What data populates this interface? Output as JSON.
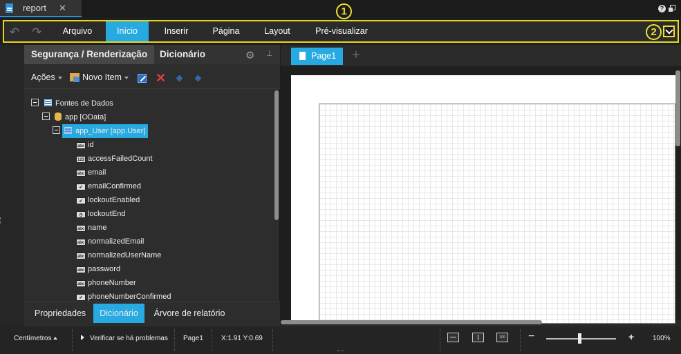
{
  "titlebar": {
    "doc_name": "report",
    "close_glyph": "✕",
    "help_glyph": "?"
  },
  "callouts": {
    "one": "1",
    "two": "2"
  },
  "menu": {
    "undo_glyph": "↶",
    "redo_glyph": "↷",
    "items": [
      "Arquivo",
      "Início",
      "Inserir",
      "Página",
      "Layout",
      "Pré-visualizar"
    ],
    "active": "Início"
  },
  "panel": {
    "tabs": [
      "Segurança / Renderização",
      "Dicionário"
    ],
    "gear_glyph": "⚙",
    "pin_glyph": "📌",
    "toolbar": {
      "actions_label": "Ações",
      "new_item_label": "Novo Item",
      "delete_glyph": "✕"
    },
    "tree": {
      "root": "Fontes de Dados",
      "source": "app [OData]",
      "table": "app_User [app.User]",
      "fields": [
        {
          "name": "id",
          "type": "abc"
        },
        {
          "name": "accessFailedCount",
          "type": "123"
        },
        {
          "name": "email",
          "type": "abc"
        },
        {
          "name": "emailConfirmed",
          "type": "✔"
        },
        {
          "name": "lockoutEnabled",
          "type": "✔"
        },
        {
          "name": "lockoutEnd",
          "type": "◷"
        },
        {
          "name": "name",
          "type": "abc"
        },
        {
          "name": "normalizedEmail",
          "type": "abc"
        },
        {
          "name": "normalizedUserName",
          "type": "abc"
        },
        {
          "name": "password",
          "type": "abc"
        },
        {
          "name": "phoneNumber",
          "type": "abc"
        },
        {
          "name": "phoneNumberConfirmed",
          "type": "✔"
        }
      ]
    },
    "bottom_tabs": [
      "Propriedades",
      "Dicionário",
      "Árvore de relatório"
    ],
    "bottom_active": "Dicionário"
  },
  "designer": {
    "page_tab": "Page1",
    "add_glyph": "+"
  },
  "statusbar": {
    "units": "Centímetros",
    "check": "Verificar se há problemas",
    "page": "Page1",
    "coords": "X:1.91 Y:0.69",
    "zoom_icon_label": "100",
    "zoom_minus": "−",
    "zoom_plus": "+",
    "zoom": "100%"
  },
  "colors": {
    "accent": "#27a9e1",
    "callout": "#f0e030"
  }
}
